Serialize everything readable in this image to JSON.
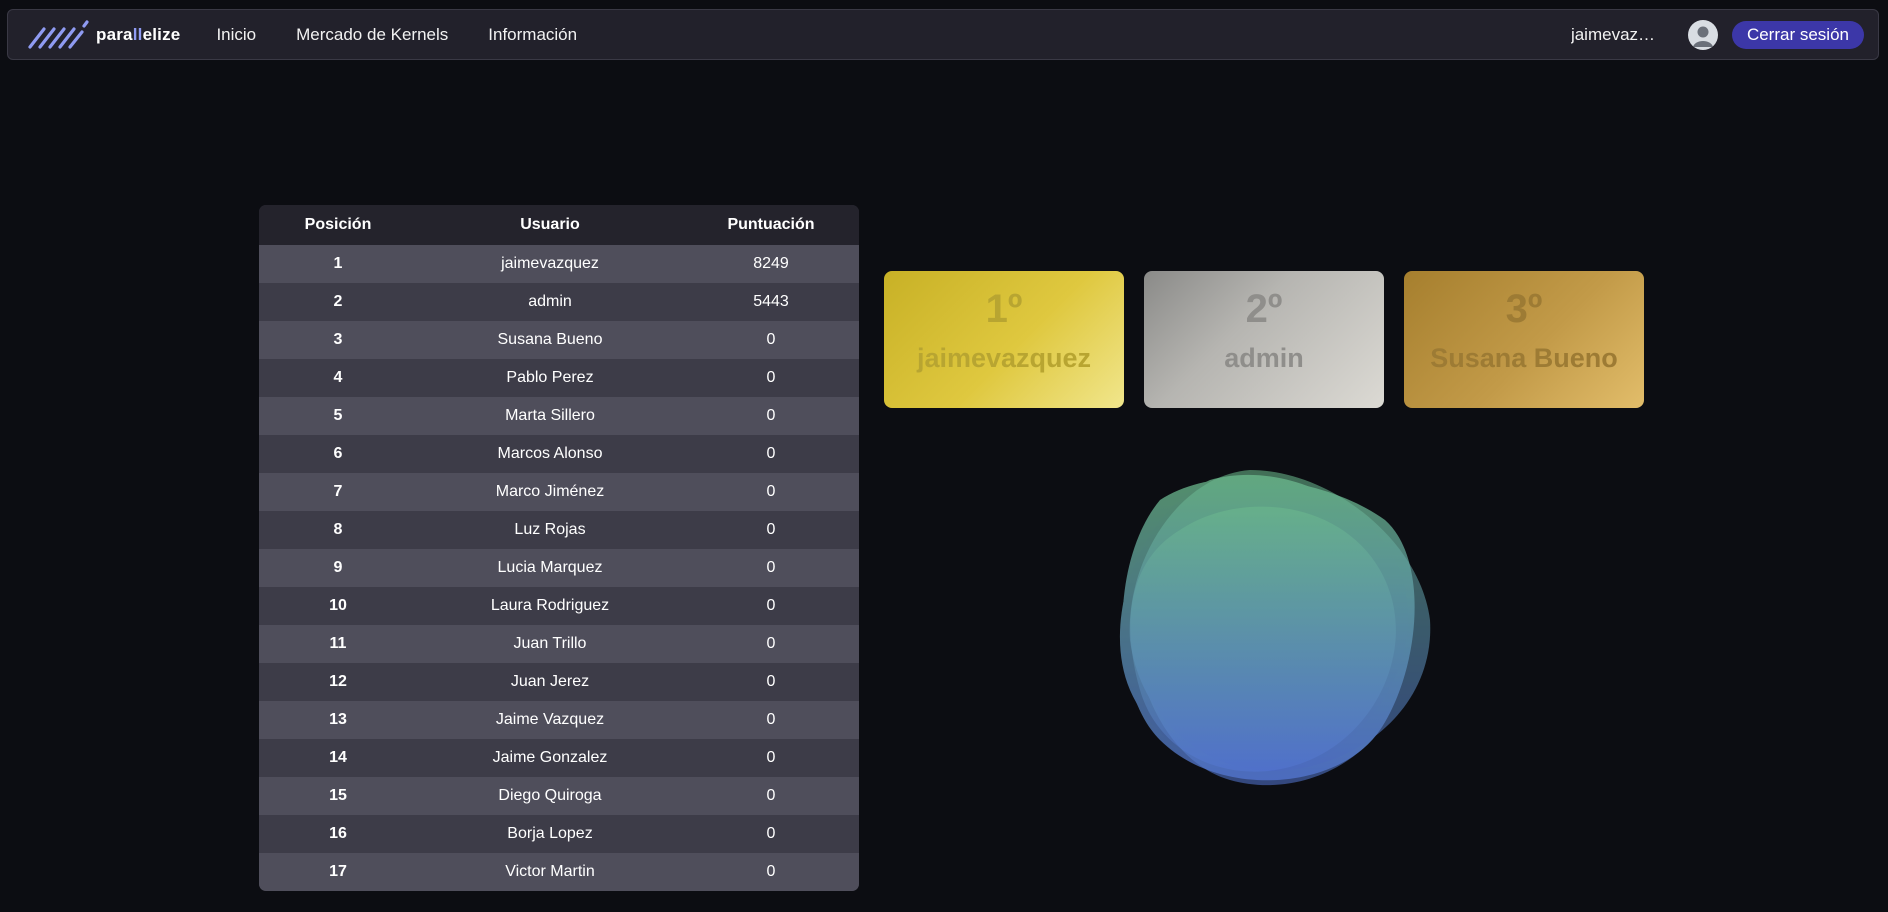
{
  "navbar": {
    "brand": {
      "prefix": "para",
      "highlight": "ll",
      "suffix": "elize"
    },
    "links": [
      "Inicio",
      "Mercado de Kernels",
      "Información"
    ],
    "username": "jaimevazquez",
    "logout_label": "Cerrar sesión"
  },
  "ranking": {
    "headers": [
      "Posición",
      "Usuario",
      "Puntuación"
    ],
    "rows": [
      {
        "pos": "1",
        "user": "jaimevazquez",
        "score": "8249"
      },
      {
        "pos": "2",
        "user": "admin",
        "score": "5443"
      },
      {
        "pos": "3",
        "user": "Susana Bueno",
        "score": "0"
      },
      {
        "pos": "4",
        "user": "Pablo Perez",
        "score": "0"
      },
      {
        "pos": "5",
        "user": "Marta Sillero",
        "score": "0"
      },
      {
        "pos": "6",
        "user": "Marcos Alonso",
        "score": "0"
      },
      {
        "pos": "7",
        "user": "Marco Jiménez",
        "score": "0"
      },
      {
        "pos": "8",
        "user": "Luz Rojas",
        "score": "0"
      },
      {
        "pos": "9",
        "user": "Lucia Marquez",
        "score": "0"
      },
      {
        "pos": "10",
        "user": "Laura Rodriguez",
        "score": "0"
      },
      {
        "pos": "11",
        "user": "Juan Trillo",
        "score": "0"
      },
      {
        "pos": "12",
        "user": "Juan Jerez",
        "score": "0"
      },
      {
        "pos": "13",
        "user": "Jaime Vazquez",
        "score": "0"
      },
      {
        "pos": "14",
        "user": "Jaime Gonzalez",
        "score": "0"
      },
      {
        "pos": "15",
        "user": "Diego Quiroga",
        "score": "0"
      },
      {
        "pos": "16",
        "user": "Borja Lopez",
        "score": "0"
      },
      {
        "pos": "17",
        "user": "Victor Martin",
        "score": "0"
      }
    ]
  },
  "podium": [
    {
      "place": "1º",
      "name": "jaimevazquez",
      "color": "#dfc83f"
    },
    {
      "place": "2º",
      "name": "admin",
      "color": "#b6b5b1"
    },
    {
      "place": "3º",
      "name": "Susana Bueno",
      "color": "#c29a48"
    }
  ],
  "colors": {
    "background": "#0c0d12",
    "navbar": "#22212b",
    "accent_button": "#3c37a8",
    "brand_accent": "#8f9bf2",
    "blob_top": "#6fc08f",
    "blob_bottom": "#5578d8"
  }
}
